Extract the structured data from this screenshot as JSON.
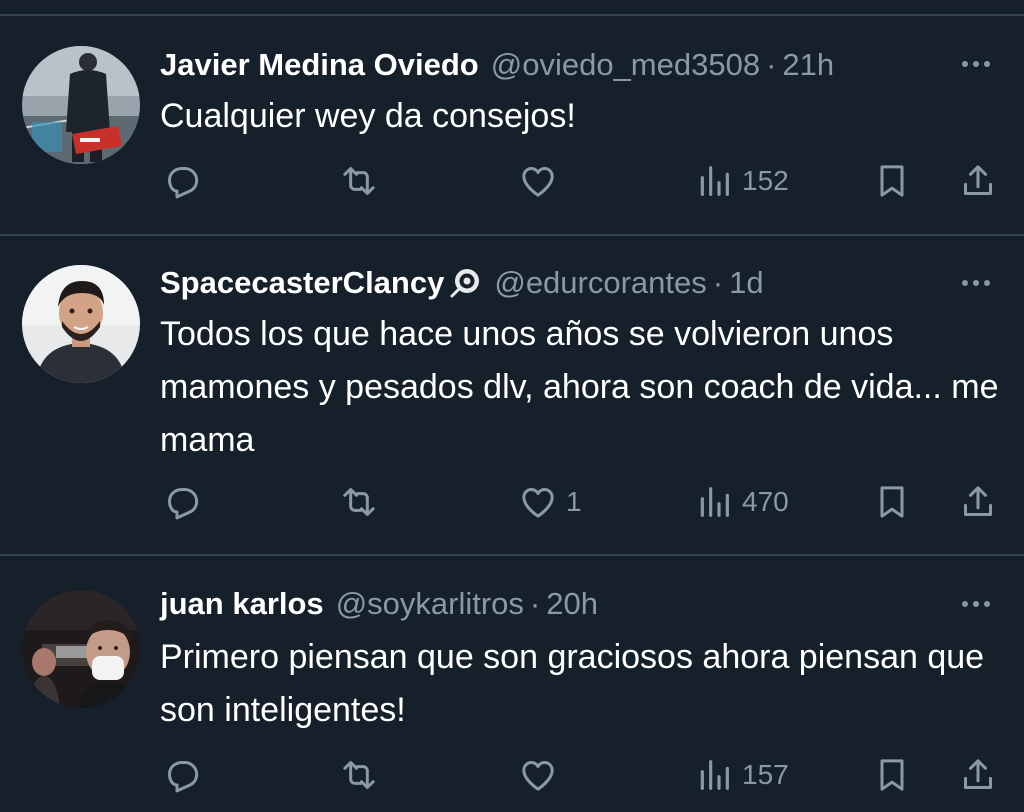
{
  "colors": {
    "background": "#15202b",
    "divider": "#38444d",
    "primary_text": "#ffffff",
    "secondary_text": "#8b98a5"
  },
  "tweets": [
    {
      "name": "Javier Medina Oviedo",
      "handle": "@oviedo_med3508",
      "separator": "·",
      "time": "21h",
      "text": "Cualquier wey da consejos!",
      "views": "152",
      "likes": "",
      "has_badge": false
    },
    {
      "name": "SpacecasterClancy",
      "handle": "@edurcorantes",
      "separator": "·",
      "time": "1d",
      "text": "Todos los que hace unos años se volvieron unos mamones y pesados dlv, ahora son coach de vida... me mama",
      "views": "470",
      "likes": "1",
      "has_badge": true,
      "badge_icon": "eye-badge-icon"
    },
    {
      "name": "juan karlos",
      "handle": "@soykarlitros",
      "separator": "·",
      "time": "20h",
      "text": "Primero piensan que son graciosos ahora piensan que son inteligentes!",
      "views": "157",
      "likes": "",
      "has_badge": false
    }
  ],
  "icons": {
    "reply": "reply-icon",
    "retweet": "retweet-icon",
    "like": "heart-icon",
    "views": "views-bar-chart-icon",
    "bookmark": "bookmark-icon",
    "share": "share-icon",
    "more": "more-dots-icon"
  }
}
